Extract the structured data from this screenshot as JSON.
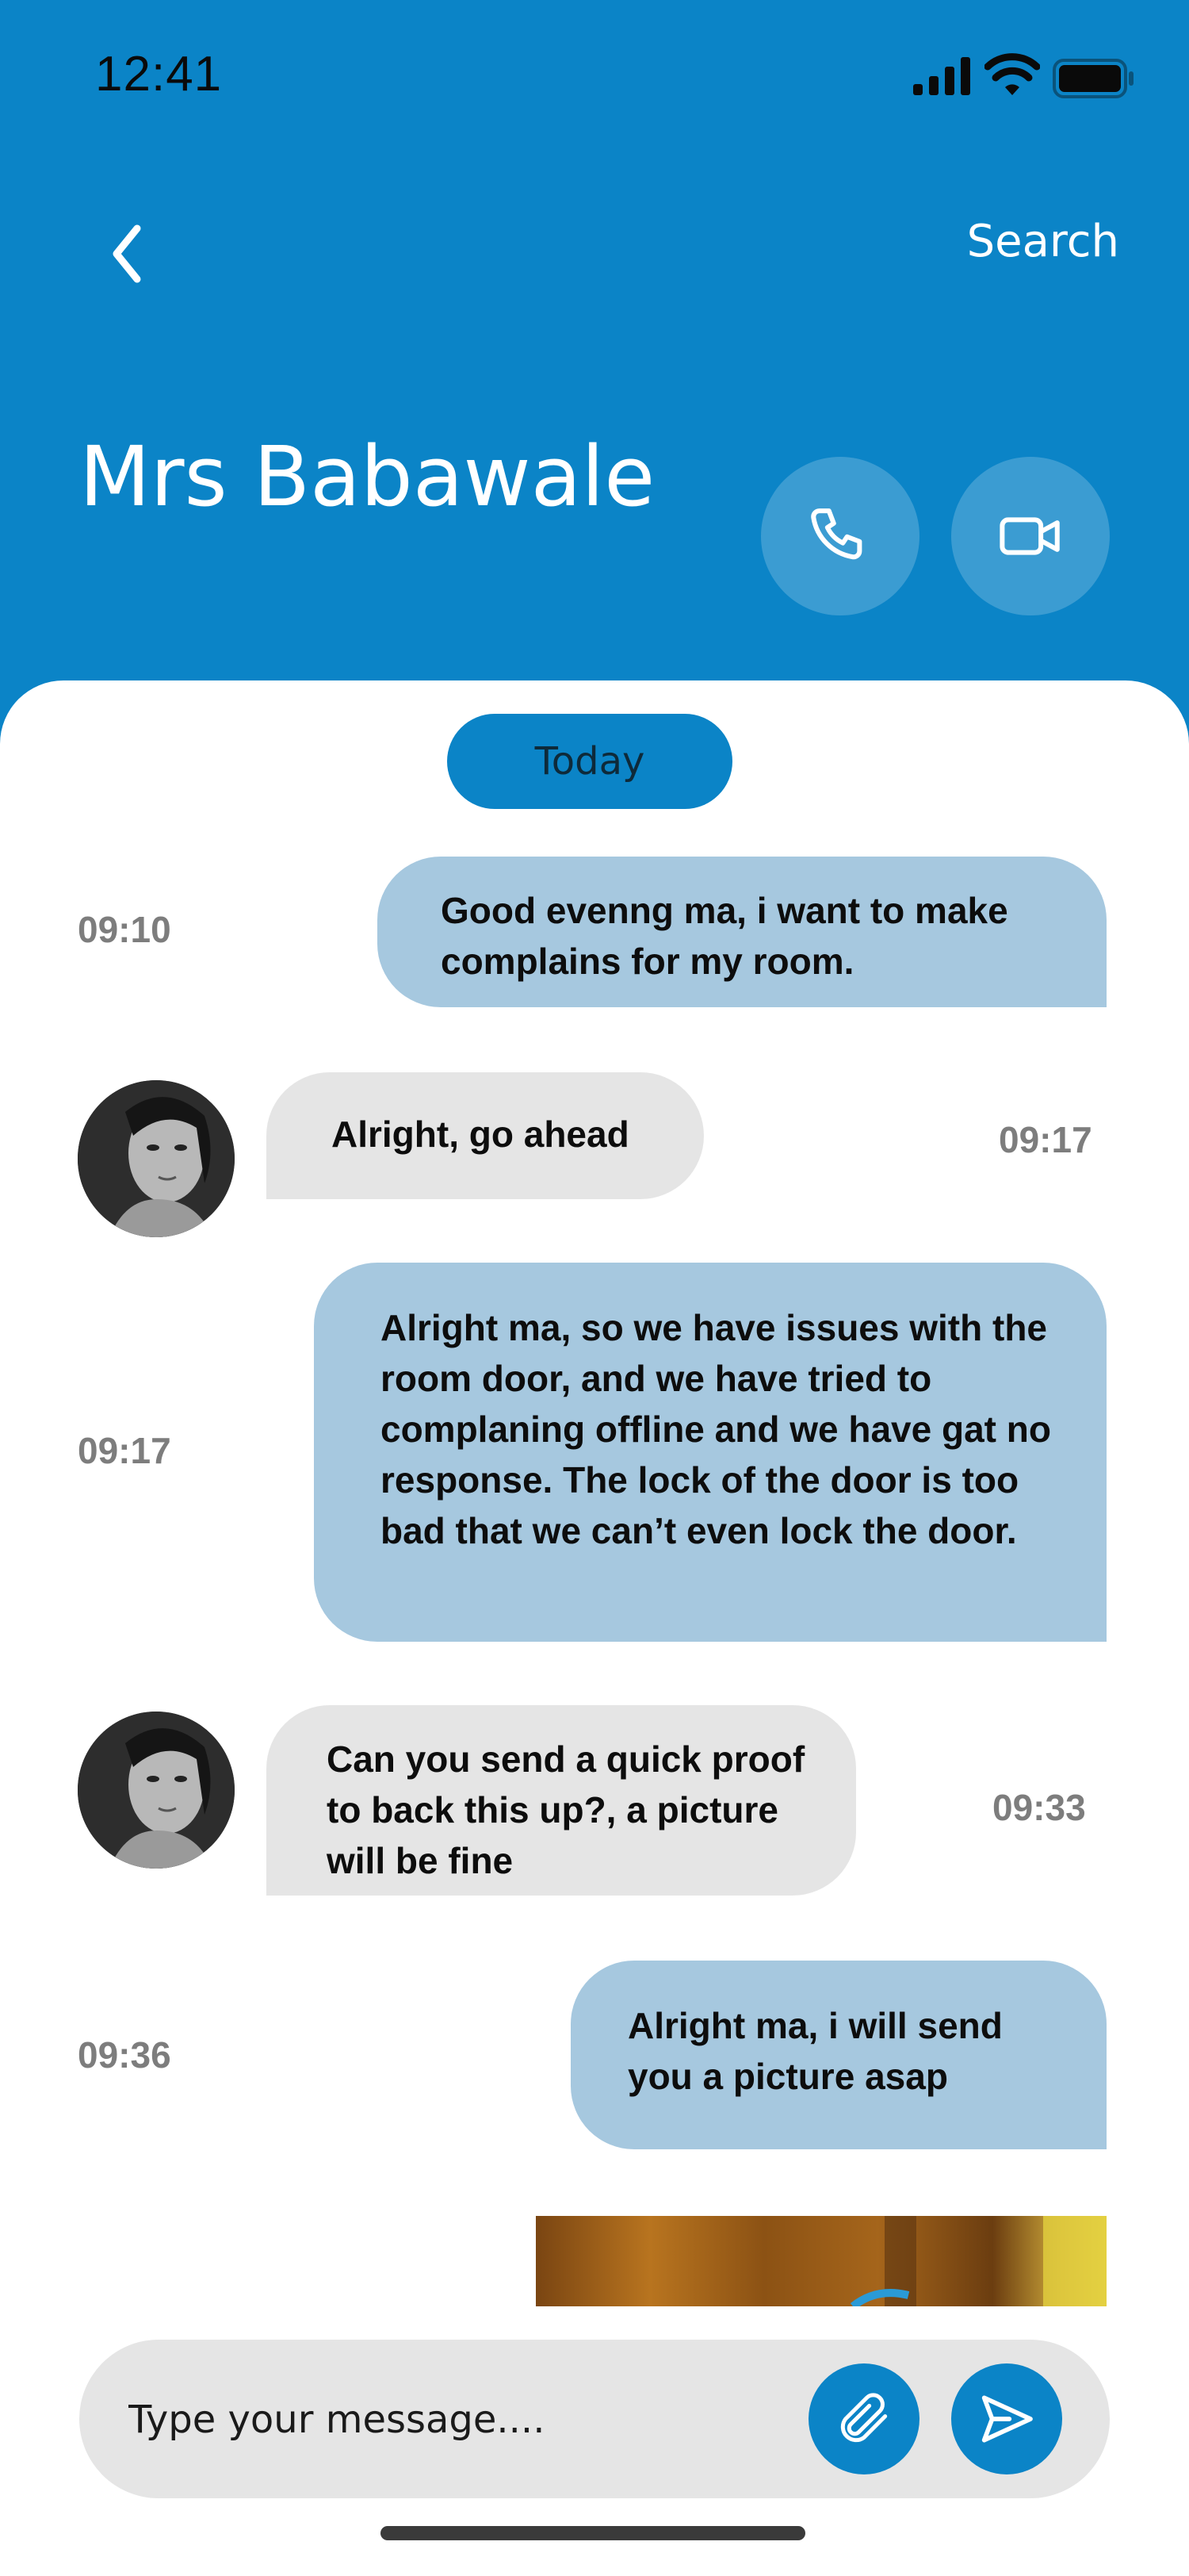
{
  "status_bar": {
    "time": "12:41"
  },
  "header": {
    "back_icon": "chevron-left-icon",
    "search_label": "Search",
    "contact_name": "Mrs Babawale",
    "call_icon": "phone-icon",
    "video_icon": "video-camera-icon"
  },
  "chat": {
    "date_label": "Today",
    "messages": [
      {
        "direction": "sent",
        "time": "09:10",
        "text": "Good evenng ma, i want to  make complains for my room."
      },
      {
        "direction": "received",
        "time": "09:17",
        "text": "Alright, go ahead"
      },
      {
        "direction": "sent",
        "time": "09:17",
        "text": "Alright ma, so we have issues with the room door, and we have tried to complaning offline and we have gat no response. The lock of the door is too bad that we can’t even lock the door."
      },
      {
        "direction": "received",
        "time": "09:33",
        "text": "Can you send a quick proof to back this up?, a picture will be fine"
      },
      {
        "direction": "sent",
        "time": "09:36",
        "text": "Alright ma, i will send you  a picture asap"
      }
    ]
  },
  "composer": {
    "placeholder": "Type your message....",
    "attach_icon": "paperclip-icon",
    "send_icon": "send-icon"
  },
  "colors": {
    "primary": "#0B84C7",
    "sent_bubble": "#A6C8DF",
    "received_bubble": "#E5E5E5",
    "timestamp": "#7D7D7D"
  }
}
